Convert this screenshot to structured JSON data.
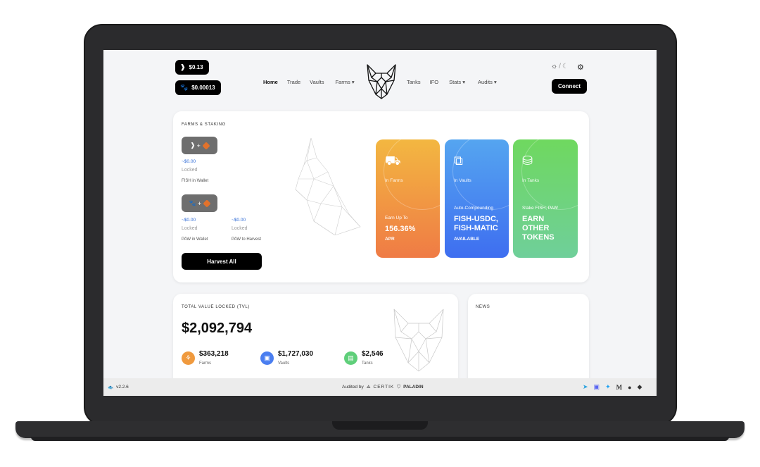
{
  "header": {
    "fish_price": "$0.13",
    "paw_price": "$0.00013",
    "nav_left": [
      "Home",
      "Trade",
      "Vaults",
      "Farms"
    ],
    "nav_right": [
      "Tanks",
      "IFO",
      "Stats",
      "Audits"
    ],
    "theme_separator": "/",
    "connect_label": "Connect"
  },
  "farms": {
    "title": "FARMS & STAKING",
    "plus": "+",
    "fish_value": "~$0.00",
    "fish_locked": "Locked",
    "fish_wallet_label": "FISH in Wallet",
    "paw_value": "~$0.00",
    "paw_locked": "Locked",
    "paw_wallet_label": "PAW in Wallet",
    "harvest_value": "~$0.00",
    "harvest_locked": "Locked",
    "harvest_label": "PAW to Harvest",
    "harvest_button": "Harvest All"
  },
  "promo": {
    "farms": {
      "sub": "In Farms",
      "small": "Earn Up To",
      "big": "156.36%",
      "tiny": "APR",
      "color_from": "#f3b741",
      "color_to": "#ef7b45"
    },
    "vaults": {
      "sub": "In Vaults",
      "small": "Auto-Compounding",
      "big1": "FISH-USDC,",
      "big2": "FISH-MATIC",
      "tiny": "AVAILABLE",
      "color_from": "#55a5f0",
      "color_to": "#3e6ef0"
    },
    "tanks": {
      "sub": "In Tanks",
      "small": "Stake FISH, PAW",
      "big1": "EARN",
      "big2": "OTHER",
      "big3": "TOKENS",
      "color_from": "#6fd85f",
      "color_to": "#6fcf9a"
    }
  },
  "tvl": {
    "title": "TOTAL VALUE LOCKED (TVL)",
    "total": "$2,092,794",
    "items": [
      {
        "value": "$363,218",
        "label": "Farms",
        "color": "#f09a3e"
      },
      {
        "value": "$1,727,030",
        "label": "Vaults",
        "color": "#4a7ef0"
      },
      {
        "value": "$2,546",
        "label": "Tanks",
        "color": "#5fcf7a"
      }
    ]
  },
  "news": {
    "title": "NEWS"
  },
  "footer": {
    "version": "v2.2.6",
    "audited_by": "Audited by",
    "certik": "CERTIK",
    "paladin": "PALADIN"
  }
}
